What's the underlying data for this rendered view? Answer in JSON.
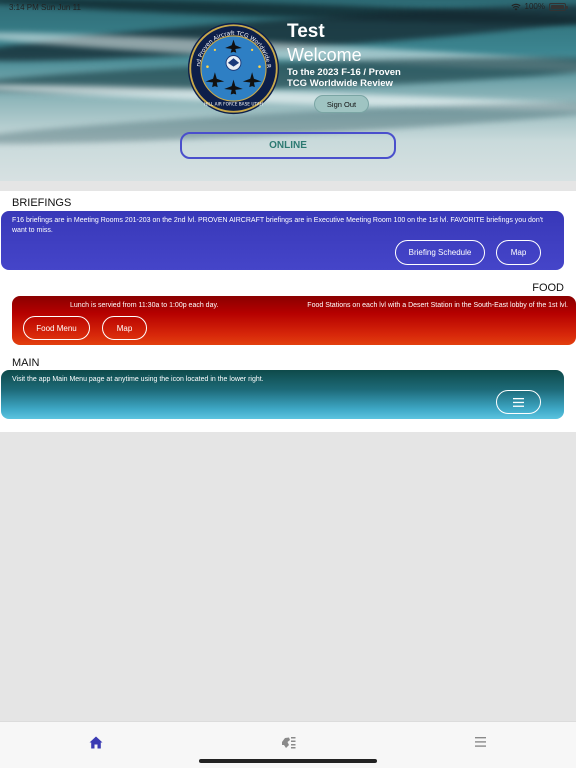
{
  "status_bar": {
    "left": "3:14 PM  Sun Jun 11",
    "battery": "100%"
  },
  "hero": {
    "title": "Test",
    "welcome": "Welcome",
    "subtitle": "To the 2023 F-16 / Proven TCG Worldwide Review",
    "signout_label": "Sign Out",
    "online_label": "ONLINE",
    "seal_text_top": "F-16 and Proven Aircraft TCG Worldwide Review",
    "seal_text_bottom": "HILL AIR FORCE BASE UTAH"
  },
  "briefings": {
    "title": "BRIEFINGS",
    "text": "F16 briefings are in Meeting Rooms 201-203 on the 2nd lvl.  PROVEN AIRCRAFT briefings are in Executive Meeting Room 100 on the 1st lvl. FAVORITE briefings you don't want to miss.",
    "schedule_label": "Briefing Schedule",
    "map_label": "Map"
  },
  "food": {
    "title": "FOOD",
    "lunch_text": "Lunch is servied from 11:30a to 1:00p each day.",
    "stations_text": "Food Stations on each lvl with a Desert Station in the South-East lobby of the 1st lvl.",
    "menu_label": "Food Menu",
    "map_label": "Map"
  },
  "main": {
    "title": "MAIN",
    "text": "Visit the app Main Menu page at anytime using the icon located in the lower right.",
    "menu_icon": "hamburger-icon"
  },
  "tabbar": {
    "items": [
      {
        "icon": "home-icon",
        "active": true
      },
      {
        "icon": "briefings-icon",
        "active": false
      },
      {
        "icon": "menu-icon",
        "active": false
      }
    ],
    "active_color": "#3b3bb3",
    "inactive_color": "#8a8a8a"
  },
  "colors": {
    "briefing_card": "#4040c0",
    "food_card": "#b00000",
    "main_card": "#2a8aa0",
    "online_border": "#4a4fcc",
    "online_text": "#2d7a72"
  }
}
